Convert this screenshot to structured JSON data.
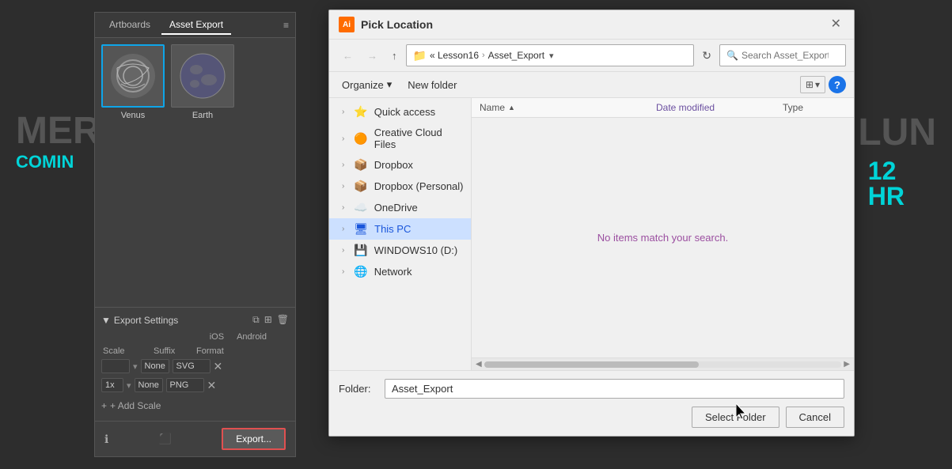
{
  "background": {
    "left_text": "MER",
    "sub_text": "COMIN",
    "right_text": "LUN",
    "number": "12\nHR"
  },
  "left_panel": {
    "tabs": [
      {
        "label": "Artboards",
        "active": false
      },
      {
        "label": "Asset Export",
        "active": true
      }
    ],
    "thumbnails": [
      {
        "label": "Venus",
        "selected": false
      },
      {
        "label": "Earth",
        "selected": false
      }
    ],
    "export_settings_label": "Export Settings",
    "ios_label": "iOS",
    "android_label": "Android",
    "rows": [
      {
        "scale": "",
        "suffix": "None",
        "format": "SVG"
      },
      {
        "scale": "1x",
        "suffix": "None",
        "format": "PNG"
      }
    ],
    "add_scale_label": "+ Add Scale",
    "export_btn_label": "Export..."
  },
  "dialog": {
    "title": "Pick Location",
    "ai_label": "Ai",
    "nav": {
      "breadcrumb_prefix": "« Lesson16",
      "breadcrumb_separator": ">",
      "breadcrumb_current": "Asset_Export",
      "search_placeholder": "Search Asset_Export"
    },
    "toolbar": {
      "organize_label": "Organize",
      "new_folder_label": "New folder"
    },
    "columns": {
      "name": "Name",
      "date_modified": "Date modified",
      "type": "Type"
    },
    "sidebar_items": [
      {
        "label": "Quick access",
        "icon": "⭐",
        "active": false
      },
      {
        "label": "Creative Cloud Files",
        "icon": "🟠",
        "active": false
      },
      {
        "label": "Dropbox",
        "icon": "📦",
        "active": false
      },
      {
        "label": "Dropbox (Personal)",
        "icon": "📦",
        "active": false
      },
      {
        "label": "OneDrive",
        "icon": "☁️",
        "active": false
      },
      {
        "label": "This PC",
        "icon": "🖥",
        "active": true
      },
      {
        "label": "WINDOWS10 (D:)",
        "icon": "💾",
        "active": false
      },
      {
        "label": "Network",
        "icon": "🌐",
        "active": false
      }
    ],
    "no_items_message": "No items match your search.",
    "folder_label": "Folder:",
    "folder_value": "Asset_Export",
    "select_folder_label": "Select Folder",
    "cancel_label": "Cancel"
  }
}
